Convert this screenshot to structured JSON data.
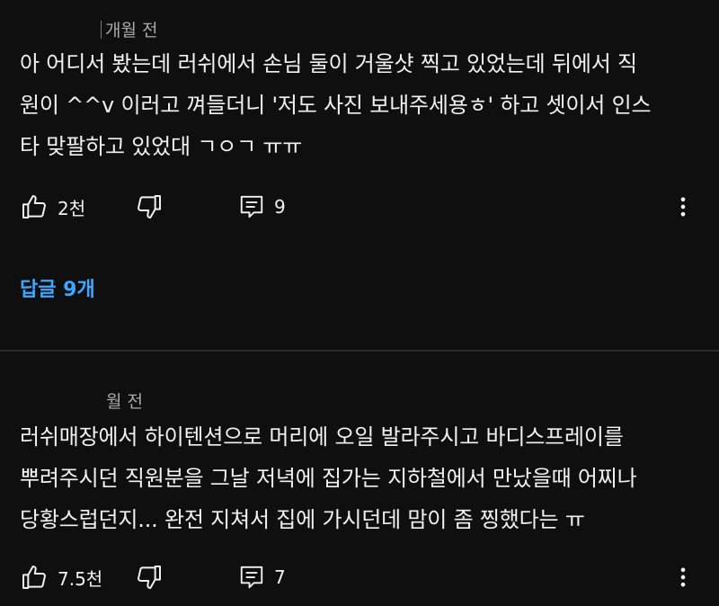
{
  "comments": [
    {
      "time": "개월 전",
      "text": "아 어디서 봤는데 러쉬에서 손님 둘이 거울샷 찍고 있었는데 뒤에서 직\n원이 ^^v 이러고 껴들더니 '저도 사진 보내주세용ㅎ' 하고 셋이서 인스\n타 맞팔하고 있었대 ㄱㅇㄱ ㅠㅠ",
      "likes": "2천",
      "reply_count": "9",
      "replies_link": "답글 9개"
    },
    {
      "time": "월 전",
      "text": "러쉬매장에서 하이텐션으로 머리에 오일 발라주시고 바디스프레이를\n뿌려주시던 직원분을 그날 저녁에 집가는 지하철에서 만났을때 어찌나\n당황스럽던지... 완전 지쳐서 집에 가시던데 맘이 좀 찡했다는 ㅠ",
      "likes": "7.5천",
      "reply_count": "7"
    }
  ],
  "icons": {
    "like": "thumbs-up-icon",
    "dislike": "thumbs-down-icon",
    "reply": "comment-icon",
    "more": "more-vertical-icon"
  },
  "colors": {
    "background": "#0f0f0f",
    "text": "#f1f1f1",
    "meta": "#aaaaaa",
    "link": "#3ea6ff"
  }
}
